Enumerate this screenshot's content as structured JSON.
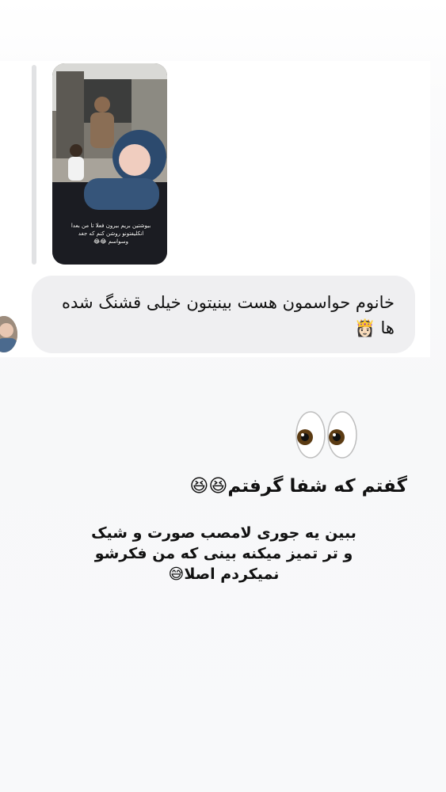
{
  "reply": {
    "story_caption": "بیوشتین بریم بیرون فعلا تا من بعدا انکلیفتونو روشن کنم که جغد وسواسم 😂😂",
    "message_text": "خانوم حواسمون هست بینیتون خیلی قشنگ شده ها 👸🏻"
  },
  "story_stickers": {
    "eyes_emoji": "👀",
    "line1": "گفتم که شفا گرفتم😆😆",
    "line2": "ببین یه جوری لامصب صورت و شیک و تر تمیز میکنه بینی که من فکرشو نمیکردم اصلا😅"
  },
  "colors": {
    "bubble": "#efeff1",
    "reply_bar": "#e1e2e4",
    "background": "#f8f9fa",
    "text": "#111111"
  },
  "icons": {
    "eyes": "eyes-emoji",
    "avatar": "user-avatar-photo"
  }
}
